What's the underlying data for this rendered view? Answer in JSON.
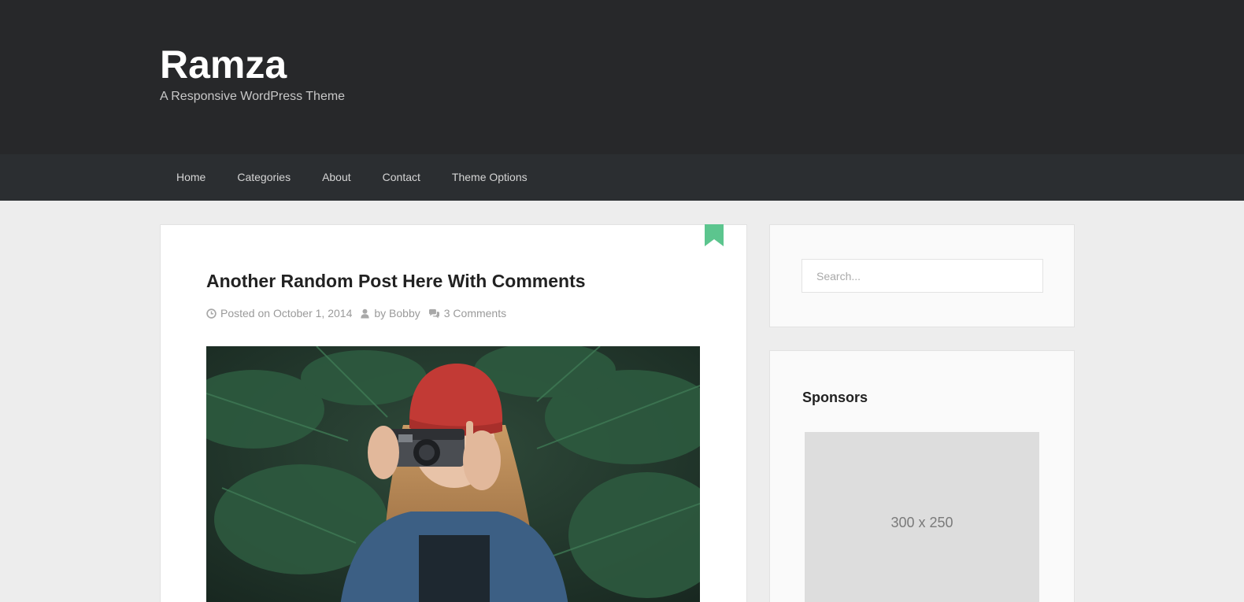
{
  "header": {
    "site_title": "Ramza",
    "site_description": "A Responsive WordPress Theme"
  },
  "nav": {
    "items": [
      "Home",
      "Categories",
      "About",
      "Contact",
      "Theme Options"
    ]
  },
  "post": {
    "title": "Another Random Post Here With Comments",
    "posted_label": "Posted on",
    "date": "October 1, 2014",
    "by_label": "by",
    "author": "Bobby",
    "comments": "3 Comments",
    "image_alt": "Woman in red beanie holding a camera among pine branches"
  },
  "sidebar": {
    "search": {
      "placeholder": "Search..."
    },
    "sponsors": {
      "title": "Sponsors",
      "ad_label": "300 x 250"
    }
  },
  "colors": {
    "header_bg": "#27282a",
    "nav_bg": "#2b2e31",
    "page_bg": "#ededed",
    "accent_green": "#5cc58e"
  },
  "icons": {
    "bookmark": "bookmark-icon",
    "clock": "clock-icon",
    "user": "user-icon",
    "comments": "comments-icon"
  }
}
